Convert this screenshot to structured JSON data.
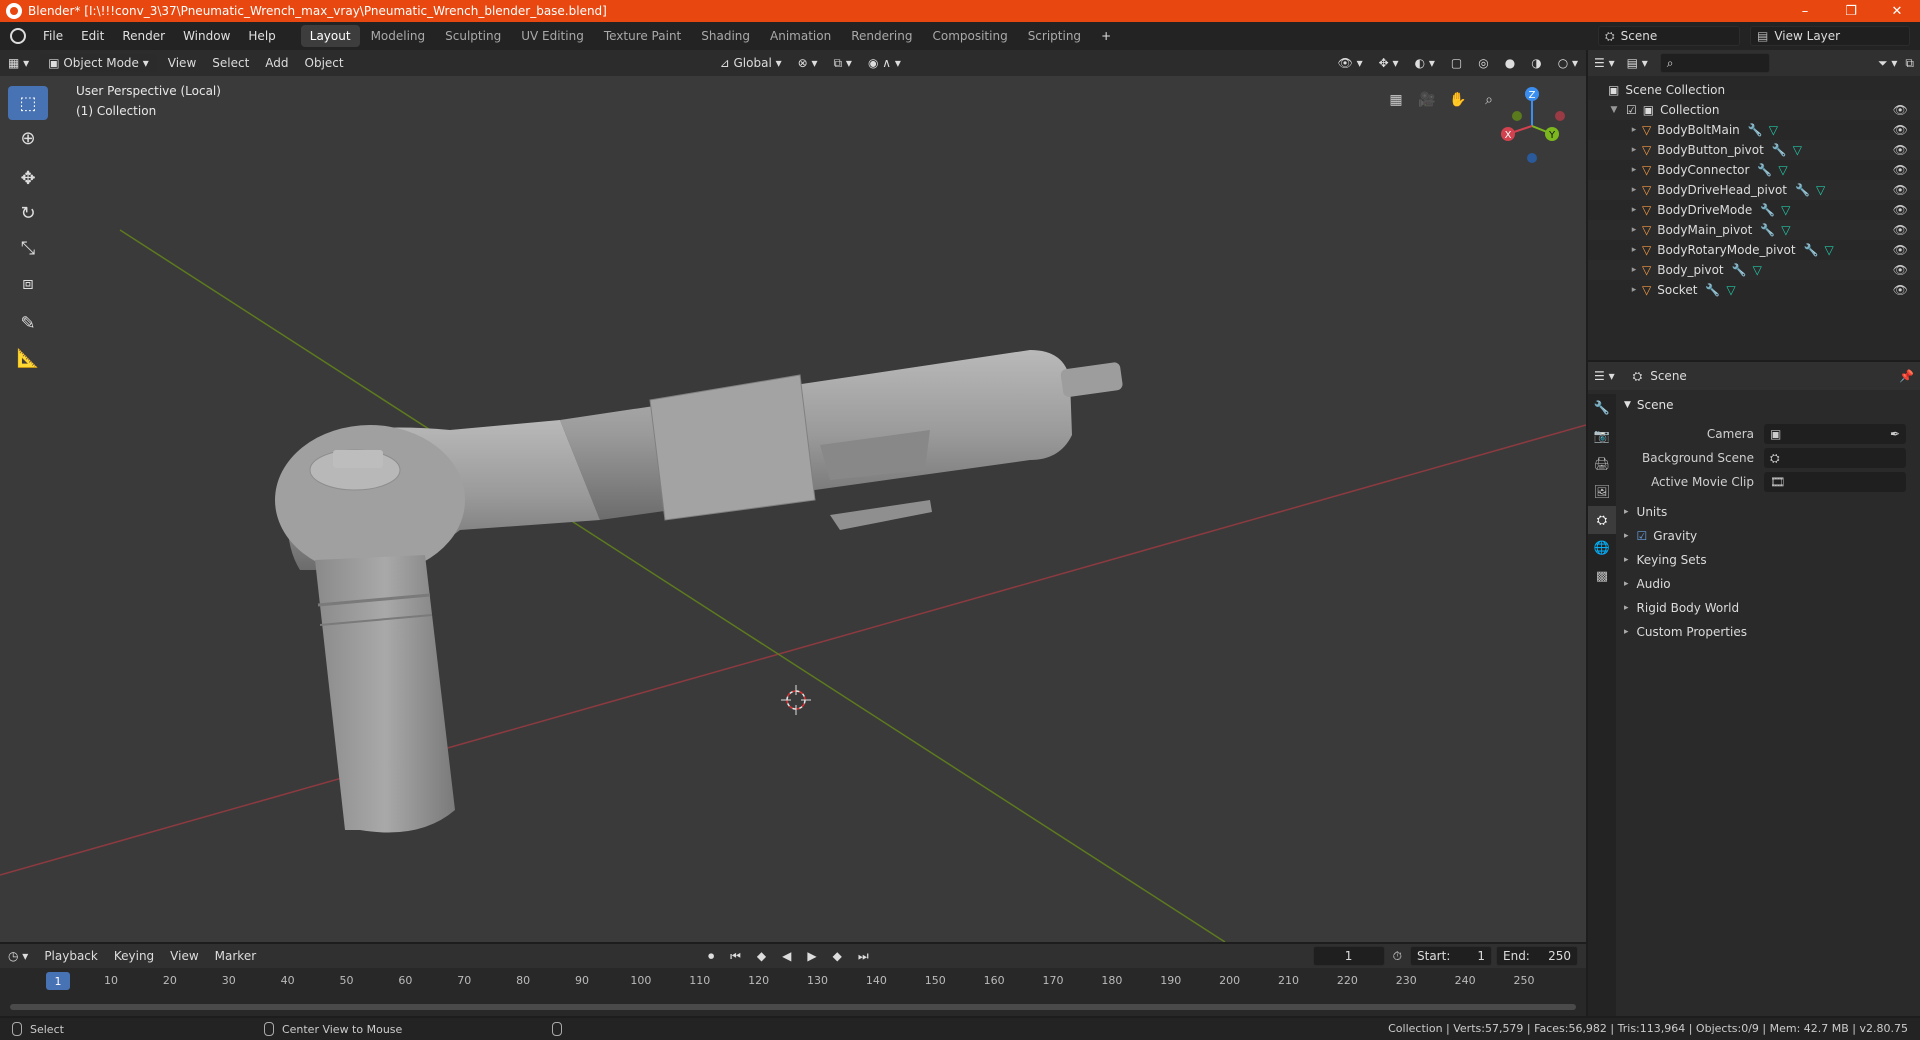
{
  "window": {
    "title": "Blender* [I:\\!!!conv_3\\37\\Pneumatic_Wrench_max_vray\\Pneumatic_Wrench_blender_base.blend]",
    "minimize": "–",
    "restore": "❐",
    "close": "✕"
  },
  "menu": [
    "File",
    "Edit",
    "Render",
    "Window",
    "Help"
  ],
  "workspaces": [
    "Layout",
    "Modeling",
    "Sculpting",
    "UV Editing",
    "Texture Paint",
    "Shading",
    "Animation",
    "Rendering",
    "Compositing",
    "Scripting"
  ],
  "add_workspace": "+",
  "scene_selector": "Scene",
  "view_layer": "View Layer",
  "viewport": {
    "mode": "Object Mode",
    "menus": [
      "View",
      "Select",
      "Add",
      "Object"
    ],
    "transform": "Global",
    "perspective_label": "User Perspective (Local)",
    "collection_label": "(1) Collection",
    "gizmo": {
      "z": "Z",
      "y": "Y",
      "x": "X"
    }
  },
  "outliner": {
    "search_placeholder": "",
    "scene_collection": "Scene Collection",
    "collection": "Collection",
    "objects": [
      "BodyBoltMain",
      "BodyButton_pivot",
      "BodyConnector",
      "BodyDriveHead_pivot",
      "BodyDriveMode",
      "BodyMain_pivot",
      "BodyRotaryMode_pivot",
      "Body_pivot",
      "Socket"
    ]
  },
  "properties": {
    "header": "Scene",
    "panel": "Scene",
    "camera_label": "Camera",
    "background_scene_label": "Background Scene",
    "active_movie_clip_label": "Active Movie Clip",
    "subpanels": [
      "Units",
      "Gravity",
      "Keying Sets",
      "Audio",
      "Rigid Body World",
      "Custom Properties"
    ]
  },
  "timeline": {
    "menus": [
      "Playback",
      "Keying",
      "View",
      "Marker"
    ],
    "current_frame": "1",
    "start_label": "Start:",
    "start": "1",
    "end_label": "End:",
    "end": "250",
    "ticks": [
      "1",
      "10",
      "20",
      "30",
      "40",
      "50",
      "60",
      "70",
      "80",
      "90",
      "100",
      "110",
      "120",
      "130",
      "140",
      "150",
      "160",
      "170",
      "180",
      "190",
      "200",
      "210",
      "220",
      "230",
      "240",
      "250"
    ]
  },
  "status": {
    "select": "Select",
    "center_view": "Center View to Mouse",
    "stats": "Collection | Verts:57,579 | Faces:56,982 | Tris:113,964 | Objects:0/9 | Mem: 42.7 MB | v2.80.75"
  },
  "colors": {
    "title_bar": "#e8470f",
    "accent": "#4772b3",
    "object_icon": "#f59a43",
    "x_axis": "#d2424e",
    "y_axis": "#7cb71e",
    "z_axis": "#3a8ef0"
  }
}
